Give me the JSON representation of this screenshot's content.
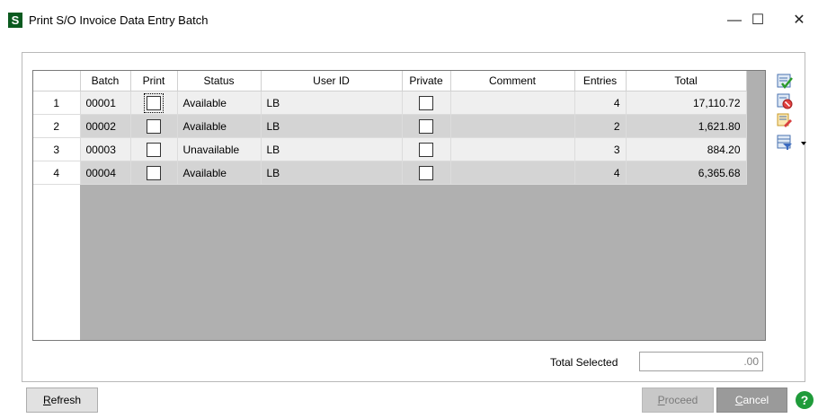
{
  "window": {
    "app_icon": "S",
    "title": "Print S/O Invoice Data Entry Batch",
    "minimize_glyph": "—",
    "maximize_glyph": "☐",
    "close_glyph": "✕"
  },
  "grid": {
    "columns": [
      "",
      "Batch",
      "Print",
      "Status",
      "User ID",
      "Private",
      "Comment",
      "Entries",
      "Total"
    ],
    "rows": [
      {
        "num": "1",
        "batch": "00001",
        "print": false,
        "status": "Available",
        "user_id": "LB",
        "private": false,
        "comment": "",
        "entries": "4",
        "total": "17,110.72"
      },
      {
        "num": "2",
        "batch": "00002",
        "print": false,
        "status": "Available",
        "user_id": "LB",
        "private": false,
        "comment": "",
        "entries": "2",
        "total": "1,621.80"
      },
      {
        "num": "3",
        "batch": "00003",
        "print": false,
        "status": "Unavailable",
        "user_id": "LB",
        "private": false,
        "comment": "",
        "entries": "3",
        "total": "884.20"
      },
      {
        "num": "4",
        "batch": "00004",
        "print": false,
        "status": "Available",
        "user_id": "LB",
        "private": false,
        "comment": "",
        "entries": "4",
        "total": "6,365.68"
      }
    ]
  },
  "side_icons": [
    "select-all-icon",
    "clear-selection-icon",
    "edit-list-icon",
    "filter-dropdown-icon"
  ],
  "total_selected": {
    "label": "Total Selected",
    "value": ".00"
  },
  "buttons": {
    "refresh": {
      "underline": "R",
      "rest": "efresh"
    },
    "proceed": {
      "underline": "P",
      "rest": "roceed"
    },
    "cancel": {
      "underline": "C",
      "rest": "ancel"
    }
  },
  "help_glyph": "?"
}
